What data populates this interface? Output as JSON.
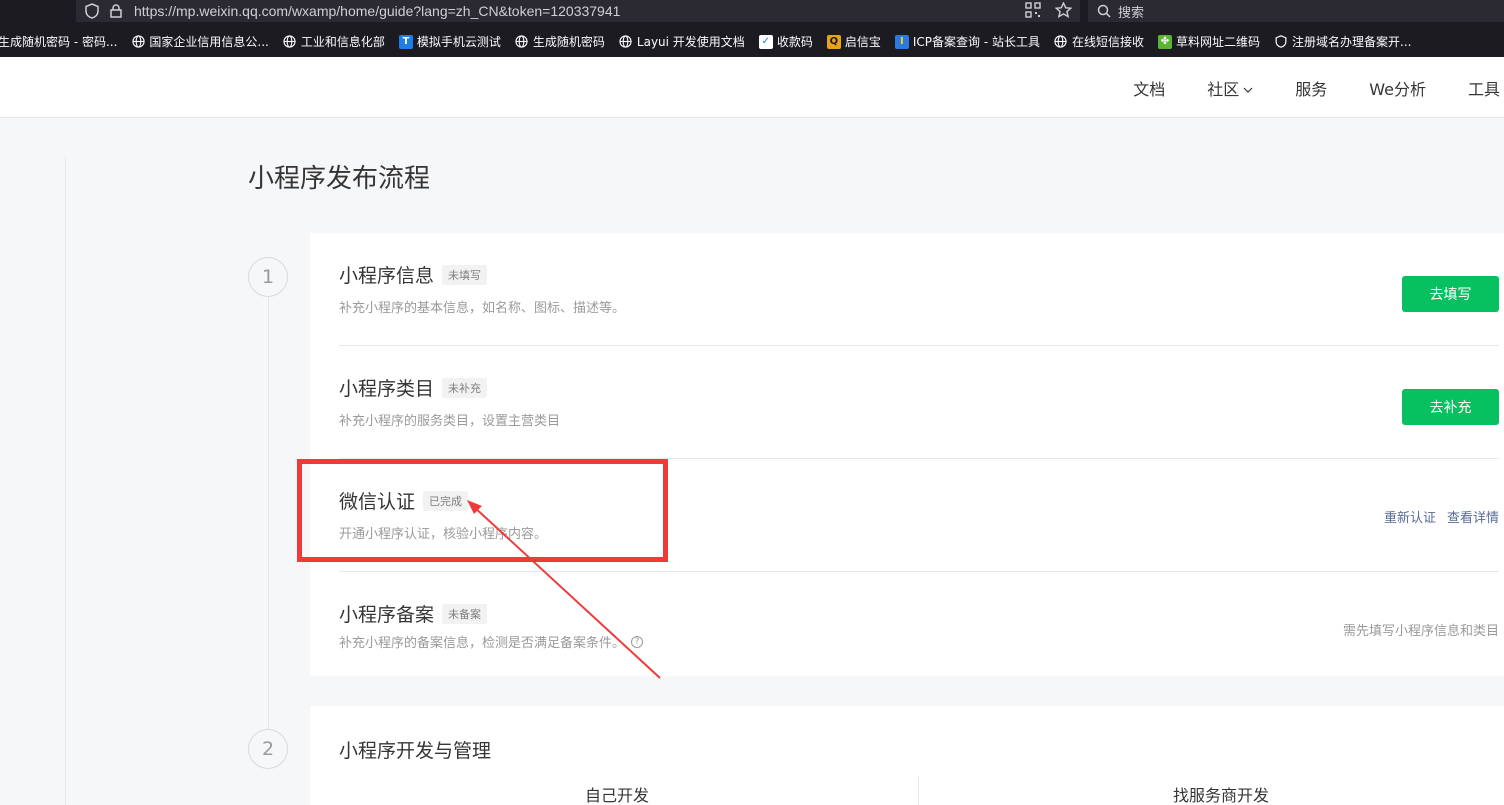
{
  "browser": {
    "url": "https://mp.weixin.qq.com/wxamp/home/guide?lang=zh_CN&token=120337941",
    "search_placeholder": "搜索"
  },
  "bookmarks": [
    {
      "label": "生成随机密码 - 密码...",
      "icon": "globe-icon"
    },
    {
      "label": "国家企业信用信息公...",
      "icon": "globe-icon"
    },
    {
      "label": "工业和信息化部",
      "icon": "globe-icon"
    },
    {
      "label": "模拟手机云测试",
      "icon": "t-logo-icon"
    },
    {
      "label": "生成随机密码",
      "icon": "globe-icon"
    },
    {
      "label": "Layui 开发使用文档",
      "icon": "globe-icon"
    },
    {
      "label": "收款码",
      "icon": "check-logo-icon"
    },
    {
      "label": "启信宝",
      "icon": "shield-logo-icon"
    },
    {
      "label": "ICP备案查询 - 站长工具",
      "icon": "icp-logo-icon"
    },
    {
      "label": "在线短信接收",
      "icon": "globe-icon"
    },
    {
      "label": "草料网址二维码",
      "icon": "grass-logo-icon"
    },
    {
      "label": "注册域名办理备案开...",
      "icon": "shield-outline-icon"
    }
  ],
  "nav": {
    "docs": "文档",
    "community": "社区",
    "services": "服务",
    "analytics": "We分析",
    "tools": "工具"
  },
  "page": {
    "title": "小程序发布流程"
  },
  "step1": {
    "number": "1",
    "rows": [
      {
        "title": "小程序信息",
        "tag": "未填写",
        "desc": "补充小程序的基本信息，如名称、图标、描述等。",
        "button": "去填写"
      },
      {
        "title": "小程序类目",
        "tag": "未补充",
        "desc": "补充小程序的服务类目，设置主营类目",
        "button": "去补充"
      },
      {
        "title": "微信认证",
        "tag": "已完成",
        "desc": "开通小程序认证，核验小程序内容。",
        "link1": "重新认证",
        "link2": "查看详情"
      },
      {
        "title": "小程序备案",
        "tag": "未备案",
        "desc": "补充小程序的备案信息，检测是否满足备案条件。",
        "hint": "需先填写小程序信息和类目"
      }
    ]
  },
  "step2": {
    "number": "2",
    "title": "小程序开发与管理",
    "col1": "自己开发",
    "col2": "找服务商开发"
  },
  "colors": {
    "primary_green": "#07c160",
    "link_blue": "#576b95",
    "annotation_red": "#f03a3a"
  }
}
